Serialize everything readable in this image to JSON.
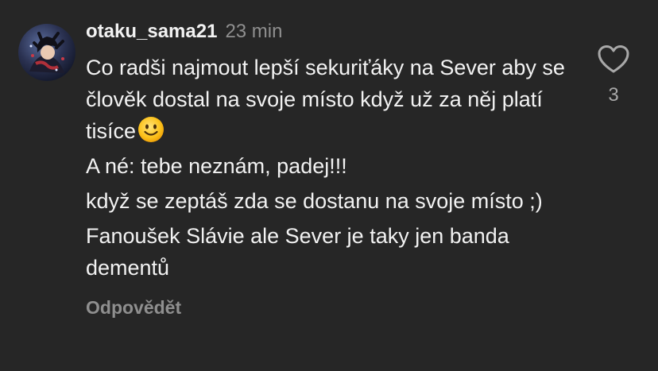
{
  "comment": {
    "username": "otaku_sama21",
    "time": "23 min",
    "paragraphs": [
      "Co radši najmout lepší sekuriťáky na Sever aby se člověk dostal na svoje místo když už za něj platí tisíce",
      "A né: tebe neznám, padej!!!",
      "když se zeptáš zda se dostanu na svoje místo ;)",
      "Fanoušek Slávie ale Sever je taky jen banda dementů"
    ],
    "emoji": "slightly-smiling-face",
    "reply_label": "Odpovědět",
    "like_icon": "heart-icon",
    "likes": "3"
  },
  "colors": {
    "background": "#262626",
    "text": "#f2f2f2",
    "secondary_text": "#8f8f8f"
  }
}
